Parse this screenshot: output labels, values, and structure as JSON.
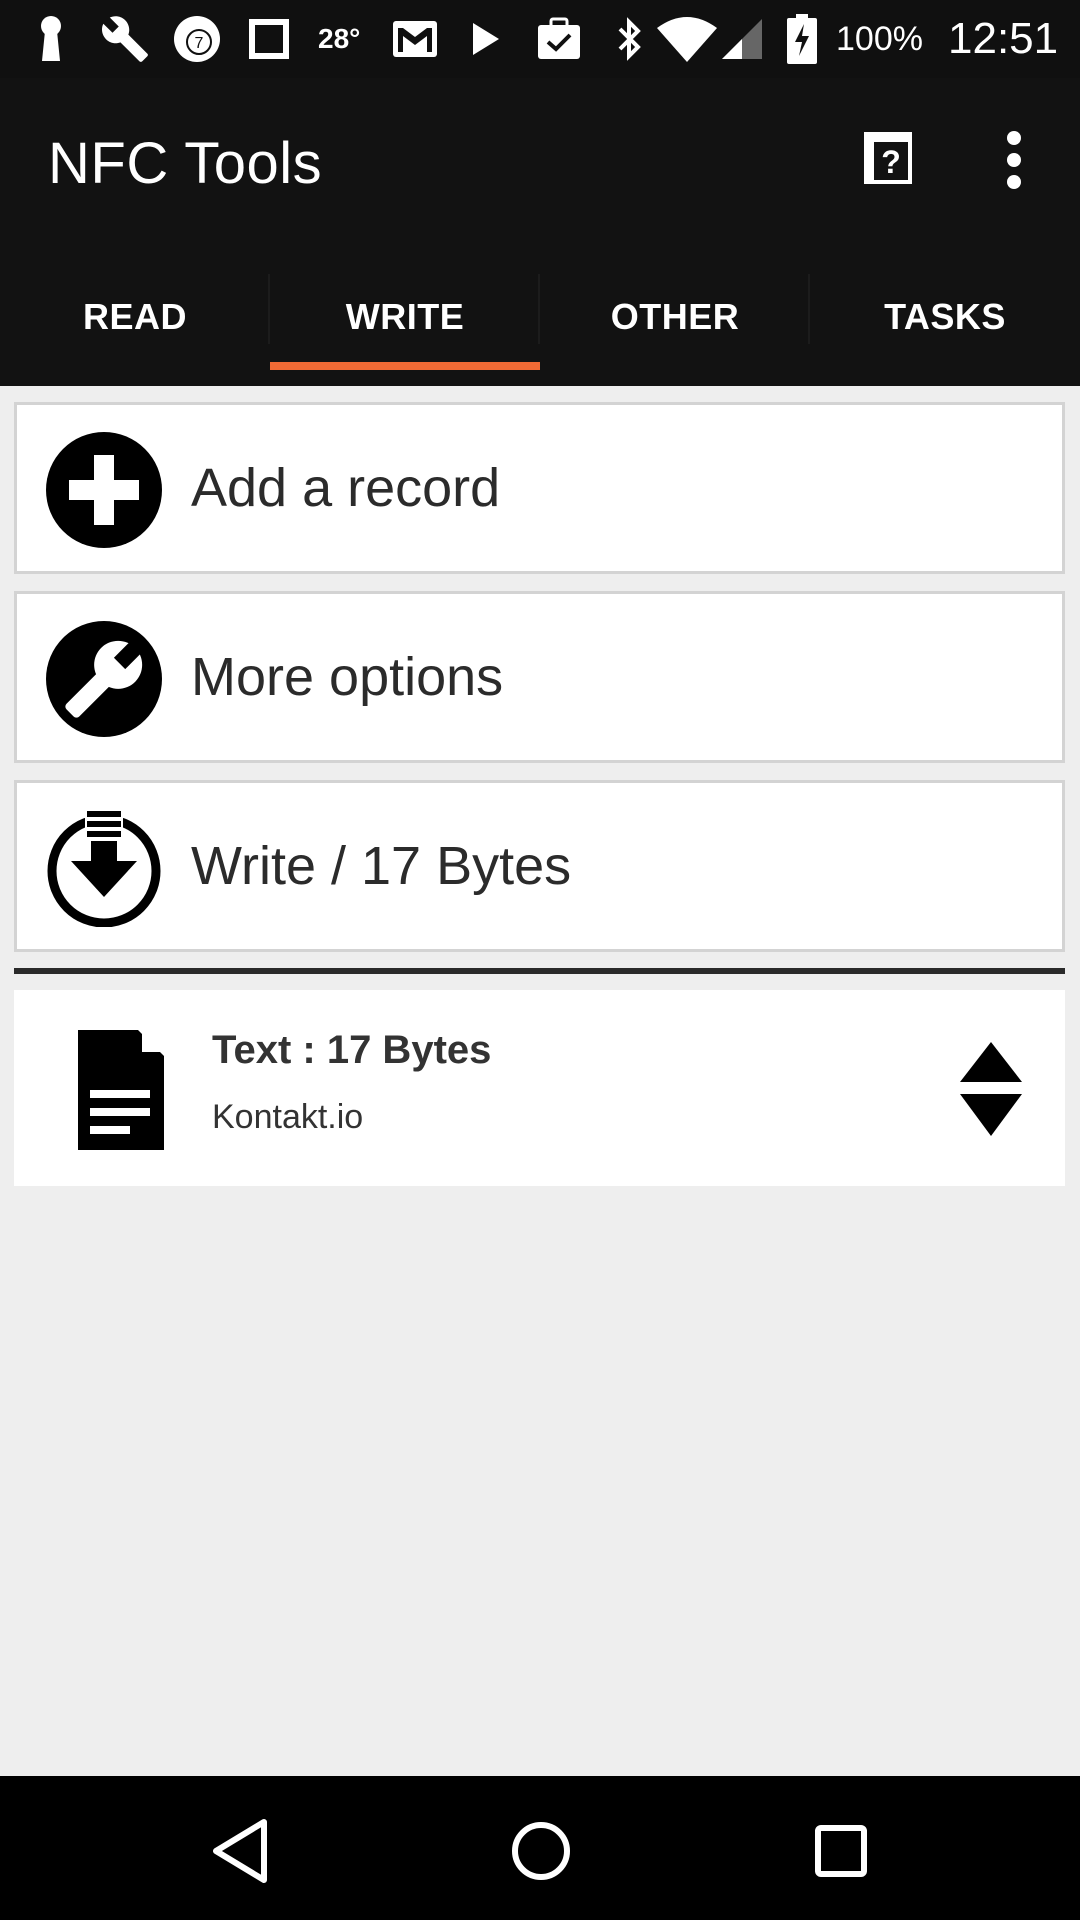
{
  "status_bar": {
    "temperature": "28°",
    "battery": "100%",
    "time": "12:51",
    "left_icons": [
      "keyhole-icon",
      "wrench-icon",
      "badge-7-icon",
      "square-icon",
      "gmail-icon",
      "play-store-icon",
      "clipboard-check-icon"
    ],
    "right_icons": [
      "bluetooth-icon",
      "wifi-icon",
      "cellular-signal-icon",
      "battery-charging-icon"
    ]
  },
  "app_bar": {
    "title": "NFC Tools",
    "help_icon": "help-book-icon",
    "menu_icon": "more-vert-icon"
  },
  "tabs": [
    {
      "label": "READ",
      "active": false
    },
    {
      "label": "WRITE",
      "active": true
    },
    {
      "label": "OTHER",
      "active": false
    },
    {
      "label": "TASKS",
      "active": false
    }
  ],
  "actions": {
    "add_record": "Add a record",
    "more_options": "More options",
    "write": "Write / 17 Bytes"
  },
  "records": [
    {
      "title": "Text : 17 Bytes",
      "value": "Kontakt.io",
      "icon": "document-icon"
    }
  ],
  "colors": {
    "accent": "#f06a35",
    "appbar": "#121212",
    "background": "#eeeeee"
  }
}
